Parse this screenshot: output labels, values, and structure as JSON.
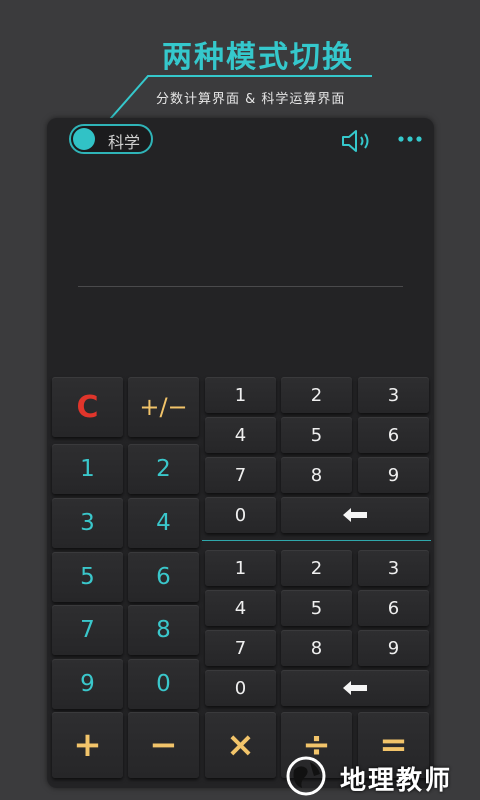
{
  "banner": {
    "headline": "两种模式切换",
    "subline": "分数计算界面 & 科学运算界面"
  },
  "toolbar": {
    "mode_toggle_label": "科学",
    "mode_toggle_on": true,
    "speaker_icon": "speaker-icon",
    "more_icon": "more-dots-icon"
  },
  "display": {
    "value": ""
  },
  "left_keys": {
    "clear": "C",
    "sign": "+/−",
    "digits": [
      "1",
      "2",
      "3",
      "4",
      "5",
      "6",
      "7",
      "8",
      "9",
      "0"
    ]
  },
  "fraction_top_keys": [
    "1",
    "2",
    "3",
    "4",
    "5",
    "6",
    "7",
    "8",
    "9",
    "0"
  ],
  "fraction_bottom_keys": [
    "1",
    "2",
    "3",
    "4",
    "5",
    "6",
    "7",
    "8",
    "9",
    "0"
  ],
  "backspace_icon": "backspace-arrow-icon",
  "operators": {
    "plus": "+",
    "minus": "−",
    "times": "×",
    "divide": "÷",
    "equals": "="
  },
  "colors": {
    "accent_teal": "#35c8cc",
    "operator_gold": "#f2c46a",
    "clear_red": "#e0352b",
    "background": "#3b3b3d",
    "panel": "#232325"
  },
  "watermark": {
    "text": "地理教师"
  }
}
